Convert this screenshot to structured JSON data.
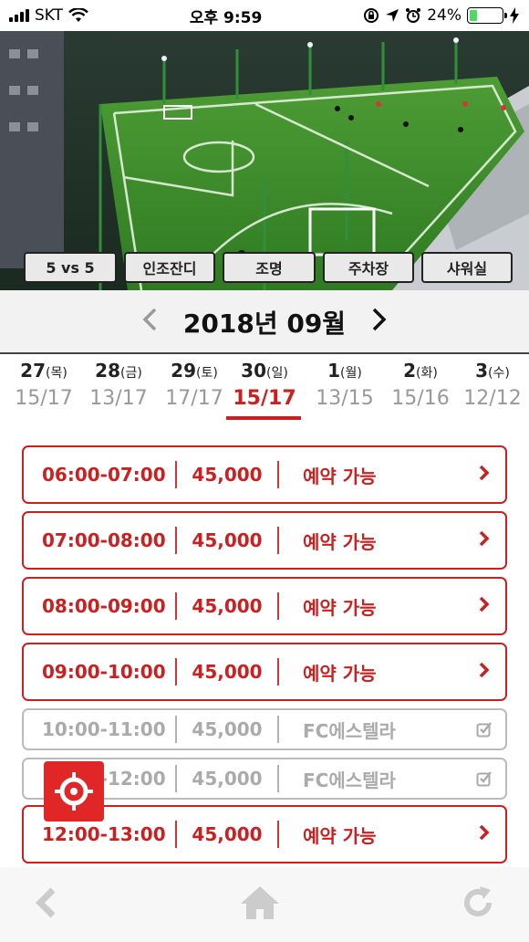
{
  "status_bar": {
    "carrier": "SKT",
    "time": "오후 9:59",
    "battery": "24%",
    "battery_level": 0.24
  },
  "facility": {
    "amenities": [
      "5 vs 5",
      "인조잔디",
      "조명",
      "주차장",
      "샤워실"
    ]
  },
  "calendar": {
    "month_title": "2018년 09월",
    "days": [
      {
        "num": "27",
        "weekday": "(목)",
        "count": "15/17",
        "active": false
      },
      {
        "num": "28",
        "weekday": "(금)",
        "count": "13/17",
        "active": false
      },
      {
        "num": "29",
        "weekday": "(토)",
        "count": "17/17",
        "active": false
      },
      {
        "num": "30",
        "weekday": "(일)",
        "count": "15/17",
        "active": true
      },
      {
        "num": "1",
        "weekday": "(월)",
        "count": "13/15",
        "active": false
      },
      {
        "num": "2",
        "weekday": "(화)",
        "count": "15/16",
        "active": false
      },
      {
        "num": "3",
        "weekday": "(수)",
        "count": "12/12",
        "active": false
      }
    ]
  },
  "slots": [
    {
      "time": "06:00-07:00",
      "price": "45,000",
      "status": "예약 가능",
      "available": true
    },
    {
      "time": "07:00-08:00",
      "price": "45,000",
      "status": "예약 가능",
      "available": true
    },
    {
      "time": "08:00-09:00",
      "price": "45,000",
      "status": "예약 가능",
      "available": true
    },
    {
      "time": "09:00-10:00",
      "price": "45,000",
      "status": "예약 가능",
      "available": true
    },
    {
      "time": "10:00-11:00",
      "price": "45,000",
      "status": "FC에스텔라",
      "available": false
    },
    {
      "time": "11:00-12:00",
      "price": "45,000",
      "status": "FC에스텔라",
      "available": false
    },
    {
      "time": "12:00-13:00",
      "price": "45,000",
      "status": "예약 가능",
      "available": true
    }
  ],
  "colors": {
    "accent": "#cc1f1f",
    "disabled": "#aaaaaa",
    "grass": "#3f9a2e"
  },
  "icons": {
    "back": "chevron-left-icon",
    "home": "home-icon",
    "refresh": "refresh-icon",
    "target": "crosshair-icon"
  }
}
